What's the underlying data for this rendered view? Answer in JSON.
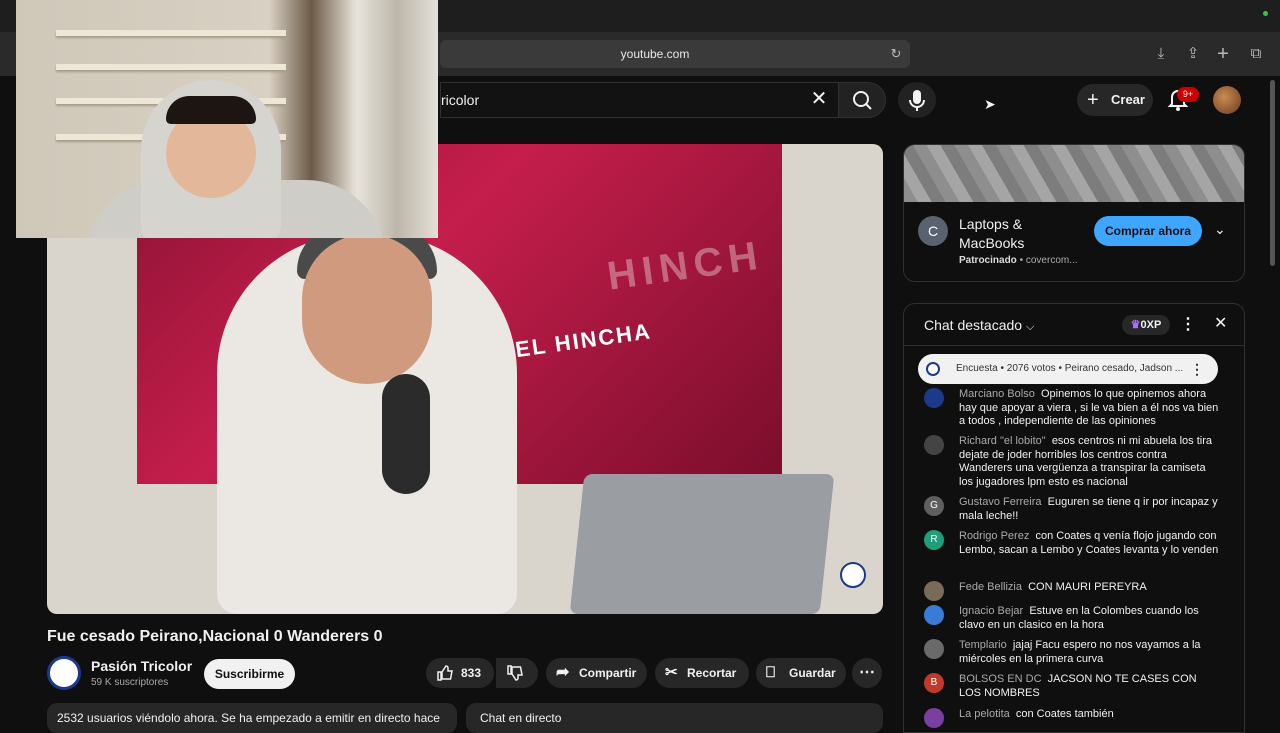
{
  "browser": {
    "url": "youtube.com"
  },
  "header": {
    "search_value": "ricolor",
    "create_label": "Crear",
    "notif_count": "9+"
  },
  "video": {
    "screen_text_main": "DEL HINCHA",
    "screen_text_faded": "HINCH",
    "title": "Fue cesado Peirano,Nacional 0 Wanderers 0",
    "channel": "Pasión Tricolor",
    "subscribers": "59 K suscriptores",
    "subscribe_label": "Suscribirme",
    "likes": "833",
    "share_label": "Compartir",
    "clip_label": "Recortar",
    "save_label": "Guardar",
    "viewers_text": "2532 usuarios viéndolo ahora. Se ha empezado a emitir en directo hace",
    "live_chat_label": "Chat en directo"
  },
  "ad": {
    "icon_letter": "C",
    "title": "Laptops & MacBooks",
    "sponsored": "Patrocinado",
    "advertiser": "covercom...",
    "cta": "Comprar ahora"
  },
  "chat": {
    "title": "Chat destacado",
    "xp": "0XP",
    "poll": "Encuesta • 2076 votos • Peirano cesado, Jadson ...",
    "messages": [
      {
        "author": "Marciano Bolso",
        "text": "Opinemos lo que opinemos ahora hay que apoyar a viera , si le va bien a él nos va bien a todos , independiente de las opiniones",
        "avatar": "",
        "color": "#1b3a8a"
      },
      {
        "author": "Richard \"el lobito\"",
        "text": "esos centros ni mi abuela los tira dejate de joder horribles los centros contra Wanderers una vergüenza a transpirar la camiseta los jugadores lpm esto es nacional",
        "avatar": "",
        "color": "#444444"
      },
      {
        "author": "Gustavo Ferreira",
        "text": "Euguren se tiene q ir por incapaz y mala leche!!",
        "avatar": "G",
        "color": "#5f5f5f"
      },
      {
        "author": "Rodrigo Perez",
        "text": "con Coates q venía flojo jugando con Lembo, sacan a Lembo y Coates levanta y lo venden",
        "avatar": "R",
        "color": "#1e9e7a"
      },
      {
        "author": "Fede Bellizia",
        "text": "CON MAURI PEREYRA",
        "avatar": "",
        "color": "#7a6a5a"
      },
      {
        "author": "Ignacio Bejar",
        "text": "Estuve en la Colombes cuando los clavo en un clasico en la hora",
        "avatar": "",
        "color": "#3b7bd8"
      },
      {
        "author": "Templario",
        "text": "jajaj Facu espero no nos vayamos a la miércoles en la primera curva",
        "avatar": "",
        "color": "#6a6a6a"
      },
      {
        "author": "BOLSOS EN DC",
        "text": "JACSON NO TE CASES CON LOS NOMBRES",
        "avatar": "B",
        "color": "#c0392b"
      },
      {
        "author": "La pelotita",
        "text": "con Coates también",
        "avatar": "",
        "color": "#7a3fa0"
      }
    ]
  }
}
